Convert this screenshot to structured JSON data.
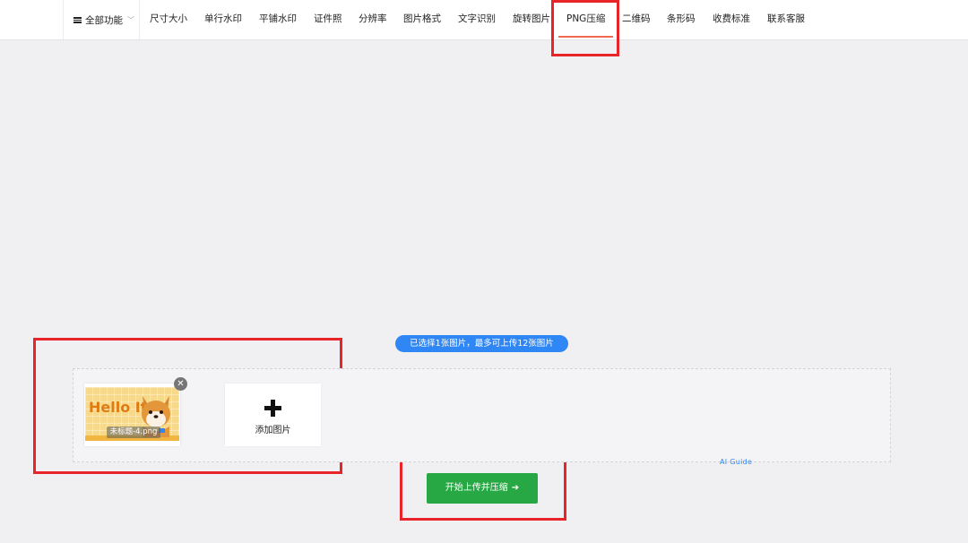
{
  "topbar": {
    "all_functions_label": "全部功能",
    "nav_items": [
      {
        "label": "尺寸大小"
      },
      {
        "label": "单行水印"
      },
      {
        "label": "平铺水印"
      },
      {
        "label": "证件照"
      },
      {
        "label": "分辨率"
      },
      {
        "label": "图片格式"
      },
      {
        "label": "文字识别"
      },
      {
        "label": "旋转图片"
      },
      {
        "label": "PNG压缩",
        "active": true
      },
      {
        "label": "二维码"
      },
      {
        "label": "条形码"
      },
      {
        "label": "收费标准"
      },
      {
        "label": "联系客服"
      }
    ]
  },
  "upload": {
    "status_text": "已选择1张图片，最多可上传12张图片",
    "file": {
      "name": "未标题-4.png",
      "image_text": "Hello It's"
    },
    "add_label": "添加图片",
    "ai_guide_label": "AI Guide",
    "start_button_label": "开始上传并压缩"
  },
  "colors": {
    "highlight_red": "#e8232a",
    "accent_blue": "#2f86f5",
    "start_green": "#28a745",
    "active_underline": "#f06a4d"
  },
  "icons": [
    "menu-icon",
    "chevron-down-icon",
    "remove-icon",
    "plus-icon",
    "arrow-right-icon"
  ]
}
